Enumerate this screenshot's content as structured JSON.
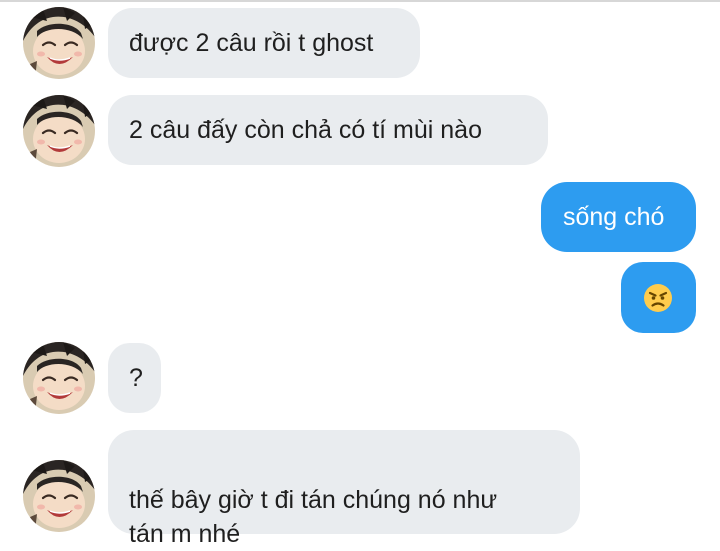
{
  "messages": [
    {
      "from": "them",
      "text": "được 2 câu rồi t ghost"
    },
    {
      "from": "them",
      "text": "2 câu đấy còn chả có tí mùi nào"
    },
    {
      "from": "me",
      "text": "sống chó"
    },
    {
      "from": "me",
      "emoji": "angry-face"
    },
    {
      "from": "them",
      "text": "?"
    },
    {
      "from": "them",
      "text": "thế bây giờ t đi tán chúng nó như\ntán m nhé"
    }
  ],
  "colors": {
    "incoming_bubble": "#e9ecef",
    "outgoing_bubble": "#2d9cf0",
    "incoming_text": "#1f1f1f",
    "outgoing_text": "#ffffff"
  }
}
